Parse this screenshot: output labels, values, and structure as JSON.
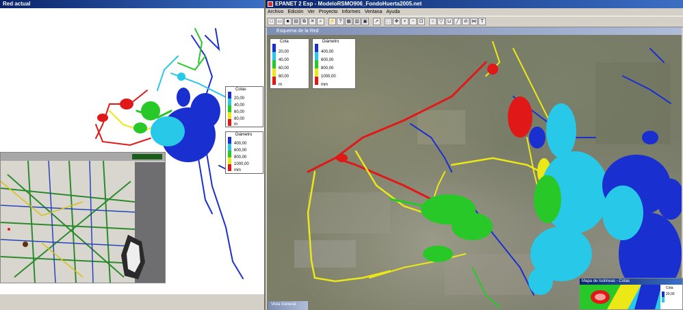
{
  "left_window": {
    "title": "Red actual",
    "legend_cota": {
      "title": "Cotas",
      "values": [
        "20,00",
        "40,00",
        "60,00",
        "80,00"
      ],
      "unit": "m"
    },
    "legend_diametro": {
      "title": "Diámetro",
      "values": [
        "400,00",
        "600,00",
        "800,00",
        "1000,00"
      ],
      "unit": "mm"
    }
  },
  "right_window": {
    "title": "EPANET 2 Esp - ModeloRSMO906_FondoHuerta2005.net",
    "menu": [
      "Archivo",
      "Edición",
      "Ver",
      "Proyecto",
      "Informes",
      "Ventana",
      "Ayuda"
    ],
    "map_title": "Esquema de la Red",
    "legend_cota": {
      "title": "Cota",
      "values": [
        "20,00",
        "40,00",
        "60,00",
        "80,00"
      ],
      "unit": "m"
    },
    "legend_diametro": {
      "title": "Diámetro",
      "values": [
        "400,00",
        "600,00",
        "800,00",
        "1000,00"
      ],
      "unit": "mm"
    },
    "bullet_window": {
      "title": "Mapa de Isolíneas - Cotas",
      "legend_title": "Cota",
      "legend_value": "20,00"
    },
    "vista_window": {
      "title": "Vista General"
    }
  },
  "colors": {
    "blue": "#1a2fcf",
    "cyan": "#27c8e8",
    "green": "#28c828",
    "yellow": "#ece818",
    "red": "#e01818",
    "titlebar": "#0a246a"
  }
}
